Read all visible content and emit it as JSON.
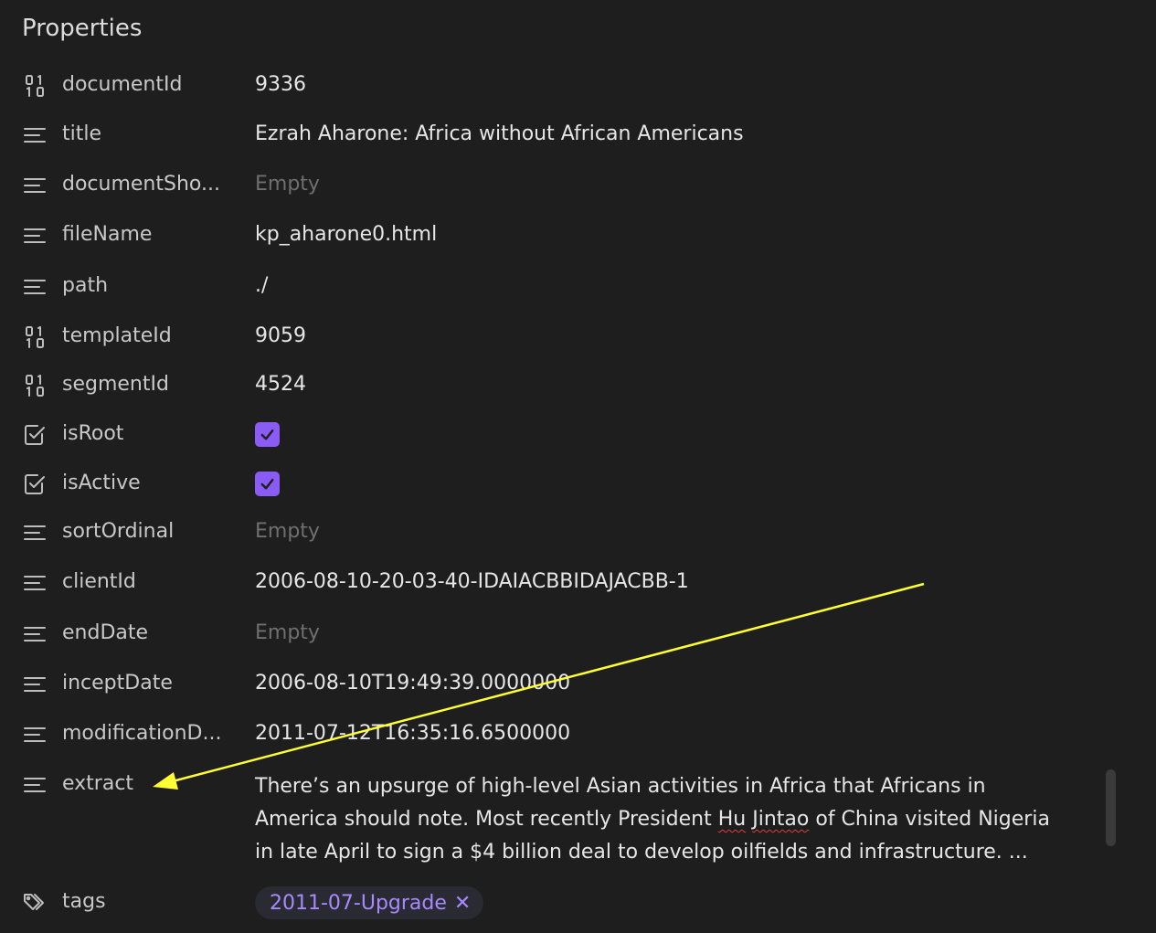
{
  "header": {
    "title": "Properties"
  },
  "properties": [
    {
      "icon": "number-icon",
      "key": "documentId",
      "value": "9336",
      "type": "number"
    },
    {
      "icon": "text-icon",
      "key": "title",
      "value": "Ezrah Aharone: Africa without African Americans",
      "type": "text"
    },
    {
      "icon": "text-icon",
      "key": "documentSho...",
      "value": "Empty",
      "type": "empty"
    },
    {
      "icon": "text-icon",
      "key": "fileName",
      "value": "kp_aharone0.html",
      "type": "text"
    },
    {
      "icon": "text-icon",
      "key": "path",
      "value": "./",
      "type": "text"
    },
    {
      "icon": "number-icon",
      "key": "templateId",
      "value": "9059",
      "type": "number"
    },
    {
      "icon": "number-icon",
      "key": "segmentId",
      "value": "4524",
      "type": "number"
    },
    {
      "icon": "checkbox-icon",
      "key": "isRoot",
      "value": true,
      "type": "checkbox"
    },
    {
      "icon": "checkbox-icon",
      "key": "isActive",
      "value": true,
      "type": "checkbox"
    },
    {
      "icon": "text-icon",
      "key": "sortOrdinal",
      "value": "Empty",
      "type": "empty"
    },
    {
      "icon": "text-icon",
      "key": "clientId",
      "value": "2006-08-10-20-03-40-IDAIACBBIDAJACBB-1",
      "type": "text"
    },
    {
      "icon": "text-icon",
      "key": "endDate",
      "value": "Empty",
      "type": "empty"
    },
    {
      "icon": "text-icon",
      "key": "inceptDate",
      "value": "2006-08-10T19:49:39.0000000",
      "type": "text"
    },
    {
      "icon": "text-icon",
      "key": "modificationD...",
      "value": "2011-07-12T16:35:16.6500000",
      "type": "text"
    }
  ],
  "extract": {
    "icon": "text-icon",
    "key": "extract",
    "line1": "There’s an upsurge of high-level Asian activities in Africa that Africans in",
    "line2_a": "America should note. Most recently President ",
    "line2_hu": "Hu",
    "line2_space": " ",
    "line2_jintao": "Jintao",
    "line2_b": " of China visited Nigeria",
    "line3": "in late April to sign a $4 billion deal to develop oilfields and infrastructure. ..."
  },
  "tags": {
    "icon": "tags-icon",
    "key": "tags",
    "items": [
      {
        "label": "2011-07-Upgrade",
        "remove": "✕"
      }
    ]
  },
  "colors": {
    "background": "#1e1e1e",
    "accent": "#8a5cf5",
    "tag_text": "#a889ff",
    "empty_text": "#6f6f6f",
    "arrow": "#ffff33"
  }
}
